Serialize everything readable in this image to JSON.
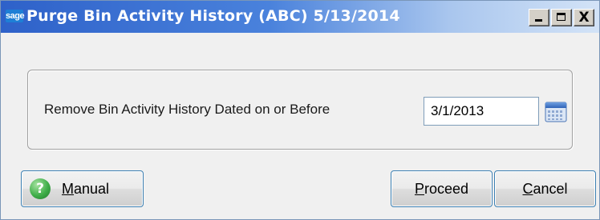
{
  "window": {
    "title": "Purge Bin Activity History (ABC) 5/13/2014",
    "logo_text": "sage",
    "controls": {
      "minimize_icon": "minimize-icon",
      "maximize_icon": "maximize-icon",
      "close_glyph": "X"
    }
  },
  "form": {
    "field_label": "Remove Bin Activity History Dated on or Before",
    "date_value": "3/1/2013",
    "calendar_icon": "calendar-icon"
  },
  "buttons": {
    "manual_label": "Manual",
    "proceed_label": "Proceed",
    "cancel_label": "Cancel",
    "help_glyph": "?"
  },
  "colors": {
    "titlebar_start": "#2e61c9",
    "titlebar_end": "#d3e3f7",
    "button_border": "#3c7fb1",
    "help_icon": "#3fae49"
  }
}
